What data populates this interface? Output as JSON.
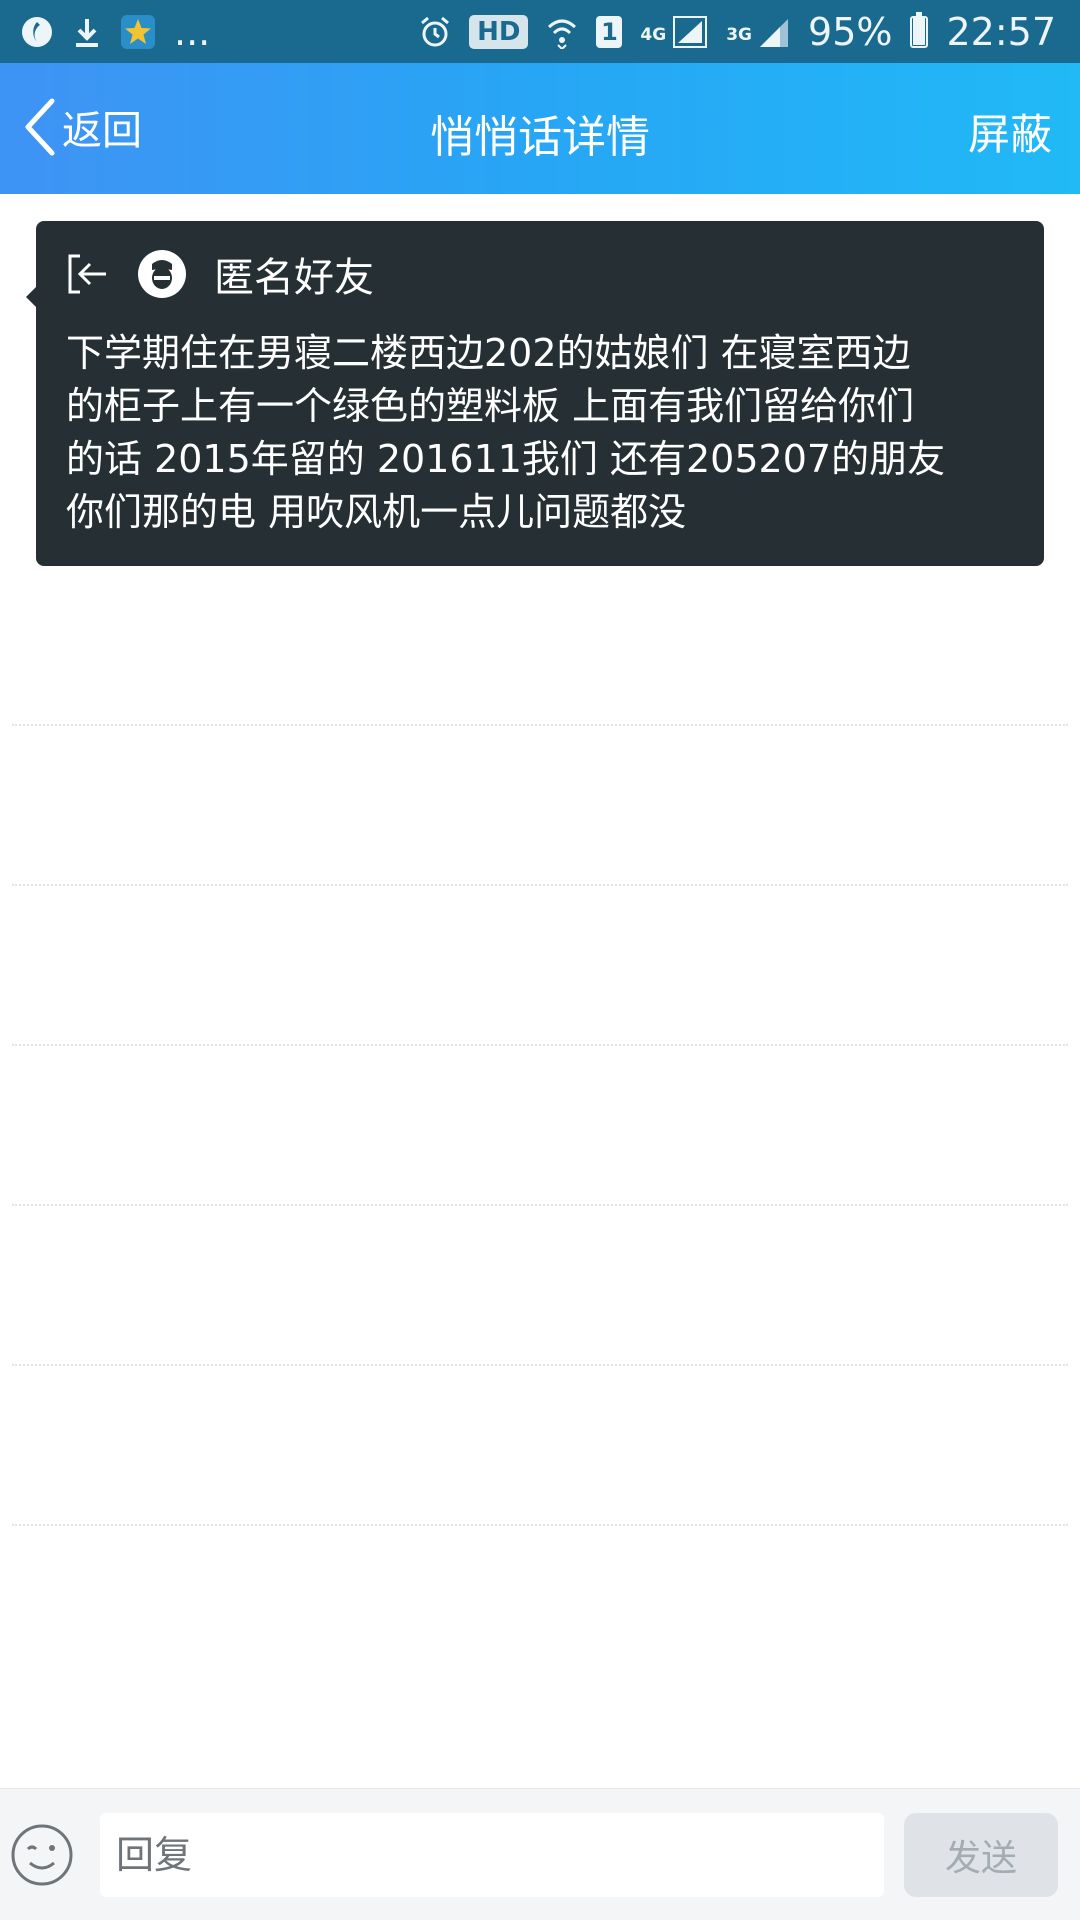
{
  "status_bar": {
    "more_notifications": "...",
    "hd_label": "HD",
    "sim_label": "1",
    "network_4g": "4G",
    "network_3g": "3G",
    "battery_percent": "95%",
    "battery_level": 0.95,
    "time": "22:57",
    "icons": [
      "qq-browser-icon",
      "download-icon",
      "star-app-icon",
      "alarm-icon",
      "wifi-icon",
      "signal-icon",
      "battery-icon"
    ]
  },
  "nav": {
    "back_label": "返回",
    "title": "悄悄话详情",
    "action_label": "屏蔽"
  },
  "message": {
    "sender": "匿名好友",
    "lines": [
      "下学期住在男寝二楼西边202的姑娘们 在寝室西边",
      "的柜子上有一个绿色的塑料板 上面有我们留给你们",
      "的话 2015年留的 201611我们 还有205207的朋友",
      "你们那的电 用吹风机一点儿问题都没"
    ]
  },
  "input": {
    "placeholder": "回复",
    "send_label": "发送"
  },
  "colors": {
    "status_bar": "#1a6a90",
    "nav_gradient_start": "#3f93f4",
    "nav_gradient_end": "#21b9f6",
    "card_bg": "#263034",
    "send_disabled_bg": "#dfe3e7"
  }
}
